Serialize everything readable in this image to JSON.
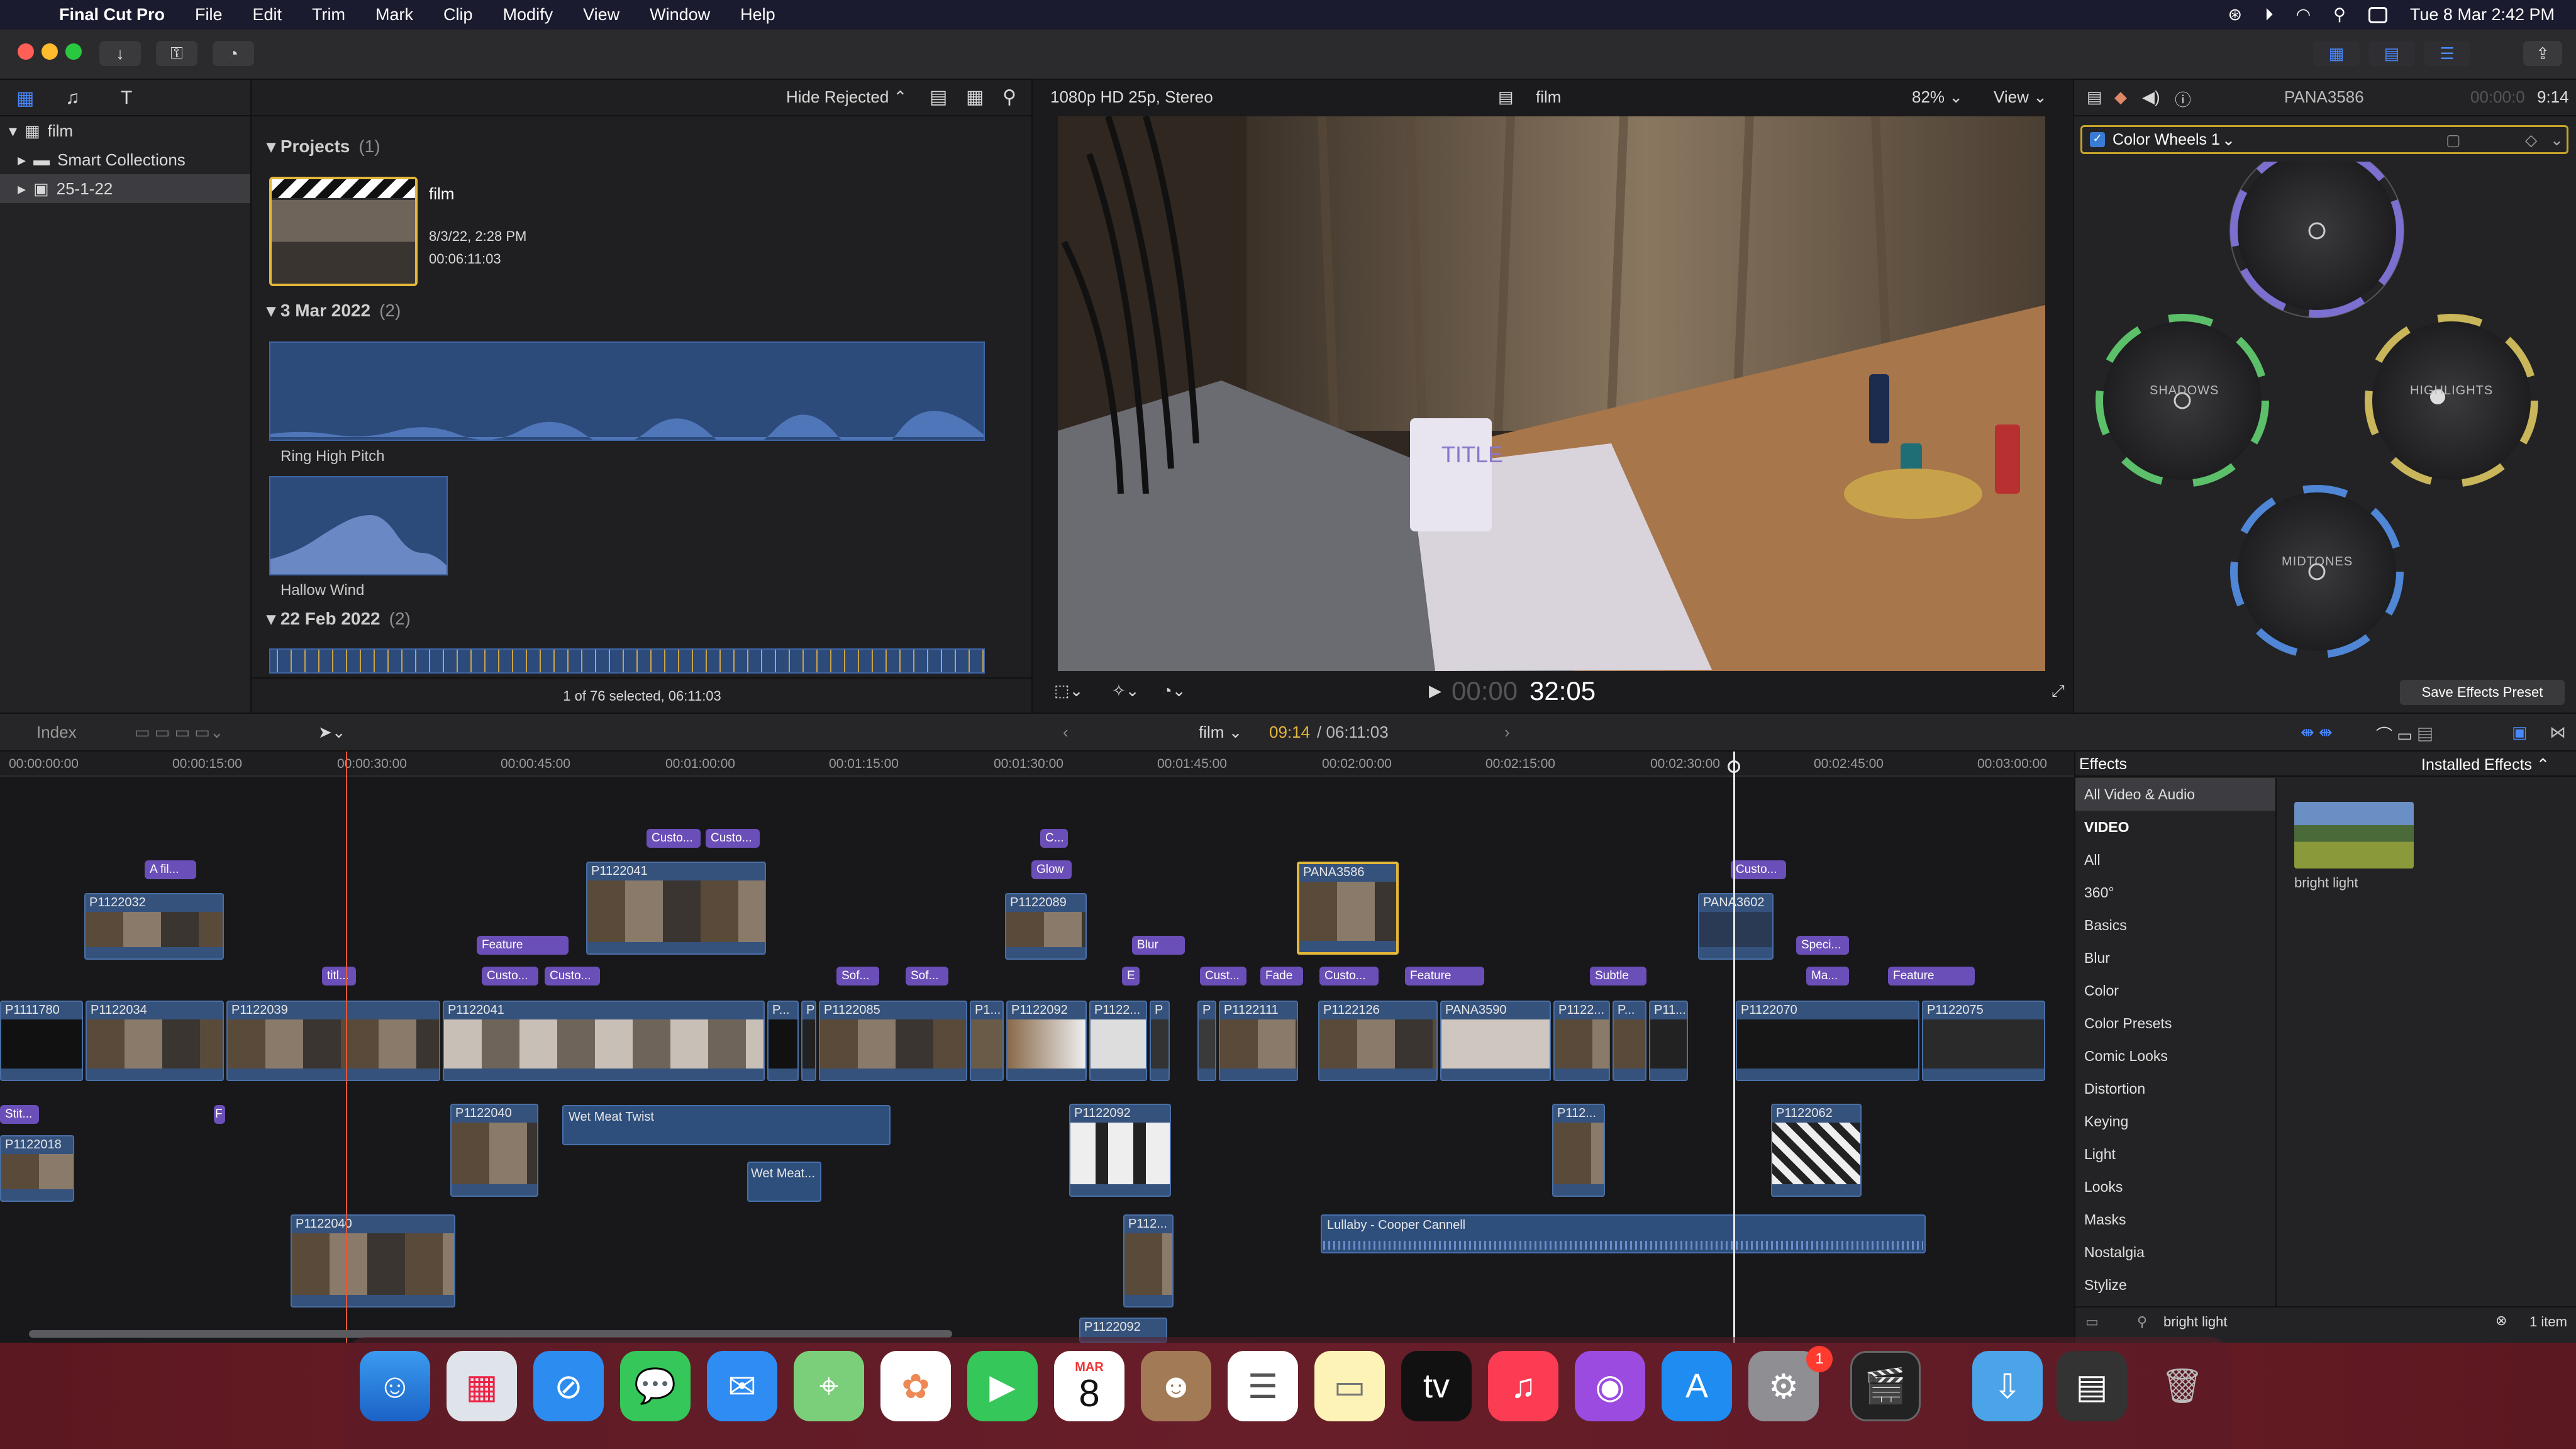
{
  "menubar": {
    "app_name": "Final Cut Pro",
    "items": [
      "File",
      "Edit",
      "Trim",
      "Mark",
      "Clip",
      "Modify",
      "View",
      "Window",
      "Help"
    ],
    "clock": "Tue 8 Mar  2:42 PM"
  },
  "library": {
    "root": "film",
    "items": [
      "Smart Collections",
      "25-1-22"
    ]
  },
  "browser": {
    "filter": "Hide Rejected",
    "groups": [
      {
        "title": "Projects",
        "count": "(1)"
      },
      {
        "title": "3 Mar 2022",
        "count": "(2)"
      },
      {
        "title": "22 Feb 2022",
        "count": "(2)"
      }
    ],
    "project": {
      "name": "film",
      "date": "8/3/22, 2:28 PM",
      "duration": "00:06:11:03"
    },
    "clips": [
      "Ring High Pitch",
      "Hallow Wind"
    ],
    "status": "1 of 76 selected, 06:11:03"
  },
  "viewer": {
    "format": "1080p HD 25p, Stereo",
    "project": "film",
    "zoom": "82%",
    "view_menu": "View",
    "overlay_title": "TITLE",
    "timecode_dim": "00:00",
    "timecode": "32:05"
  },
  "inspector": {
    "clip_name": "PANA3586",
    "duration_dim": "00:00:0",
    "duration": "9:14",
    "effect": "Color Wheels 1",
    "wheels": [
      "SHADOWS",
      "HIGHLIGHTS",
      "MIDTONES"
    ],
    "save_preset": "Save Effects Preset"
  },
  "timeline_bar": {
    "index": "Index",
    "project": "film",
    "position": "09:14",
    "total": "/ 06:11:03"
  },
  "ruler": [
    "00:00:00:00",
    "00:00:15:00",
    "00:00:30:00",
    "00:00:45:00",
    "00:01:00:00",
    "00:01:15:00",
    "00:01:30:00",
    "00:01:45:00",
    "00:02:00:00",
    "00:02:15:00",
    "00:02:30:00",
    "00:02:45:00",
    "00:03:00:00"
  ],
  "timeline": {
    "primary_clips": [
      "P1111780",
      "P1122034",
      "P1122039",
      "P1122041",
      "P...",
      "P",
      "P1122085",
      "P1...",
      "P1122092",
      "P1122...",
      "P",
      "P",
      "P1122111",
      "P1122126",
      "PANA3590",
      "P1122...",
      "P...",
      "P11...",
      "P1122070",
      "P1122075"
    ],
    "connected_upper": [
      "P1122032",
      "P1122041",
      "P1122089",
      "PANA3586",
      "PANA3602"
    ],
    "connected_lower": [
      "P1122018",
      "P1122040",
      "P1122092",
      "P112...",
      "P1122062",
      "P1122040",
      "P112...",
      "P1122092"
    ],
    "titles": [
      "A fil...",
      "Custo...",
      "Custo...",
      "C...",
      "Glow",
      "Feature",
      "Custo...",
      "Custo...",
      "Blur",
      "Custo...",
      "Speci...",
      "titl...",
      "Sof...",
      "Sof...",
      "E",
      "Cust...",
      "Fade",
      "Custo...",
      "Feature",
      "Subtle",
      "Ma...",
      "Feature",
      "Stit...",
      "F"
    ],
    "audio": [
      "Wet Meat Twist",
      "Wet Meat...",
      "Lullaby - Cooper Cannell"
    ]
  },
  "effects": {
    "header": "Effects",
    "installed": "Installed Effects",
    "categories": [
      "All Video & Audio",
      "VIDEO",
      "All",
      "360°",
      "Basics",
      "Blur",
      "Color",
      "Color Presets",
      "Comic Looks",
      "Distortion",
      "Keying",
      "Light",
      "Looks",
      "Masks",
      "Nostalgia",
      "Stylize"
    ],
    "result": "bright light",
    "search": "bright light",
    "count": "1 item"
  },
  "dock": {
    "calendar_month": "MAR",
    "calendar_day": "8",
    "badge": "1"
  }
}
